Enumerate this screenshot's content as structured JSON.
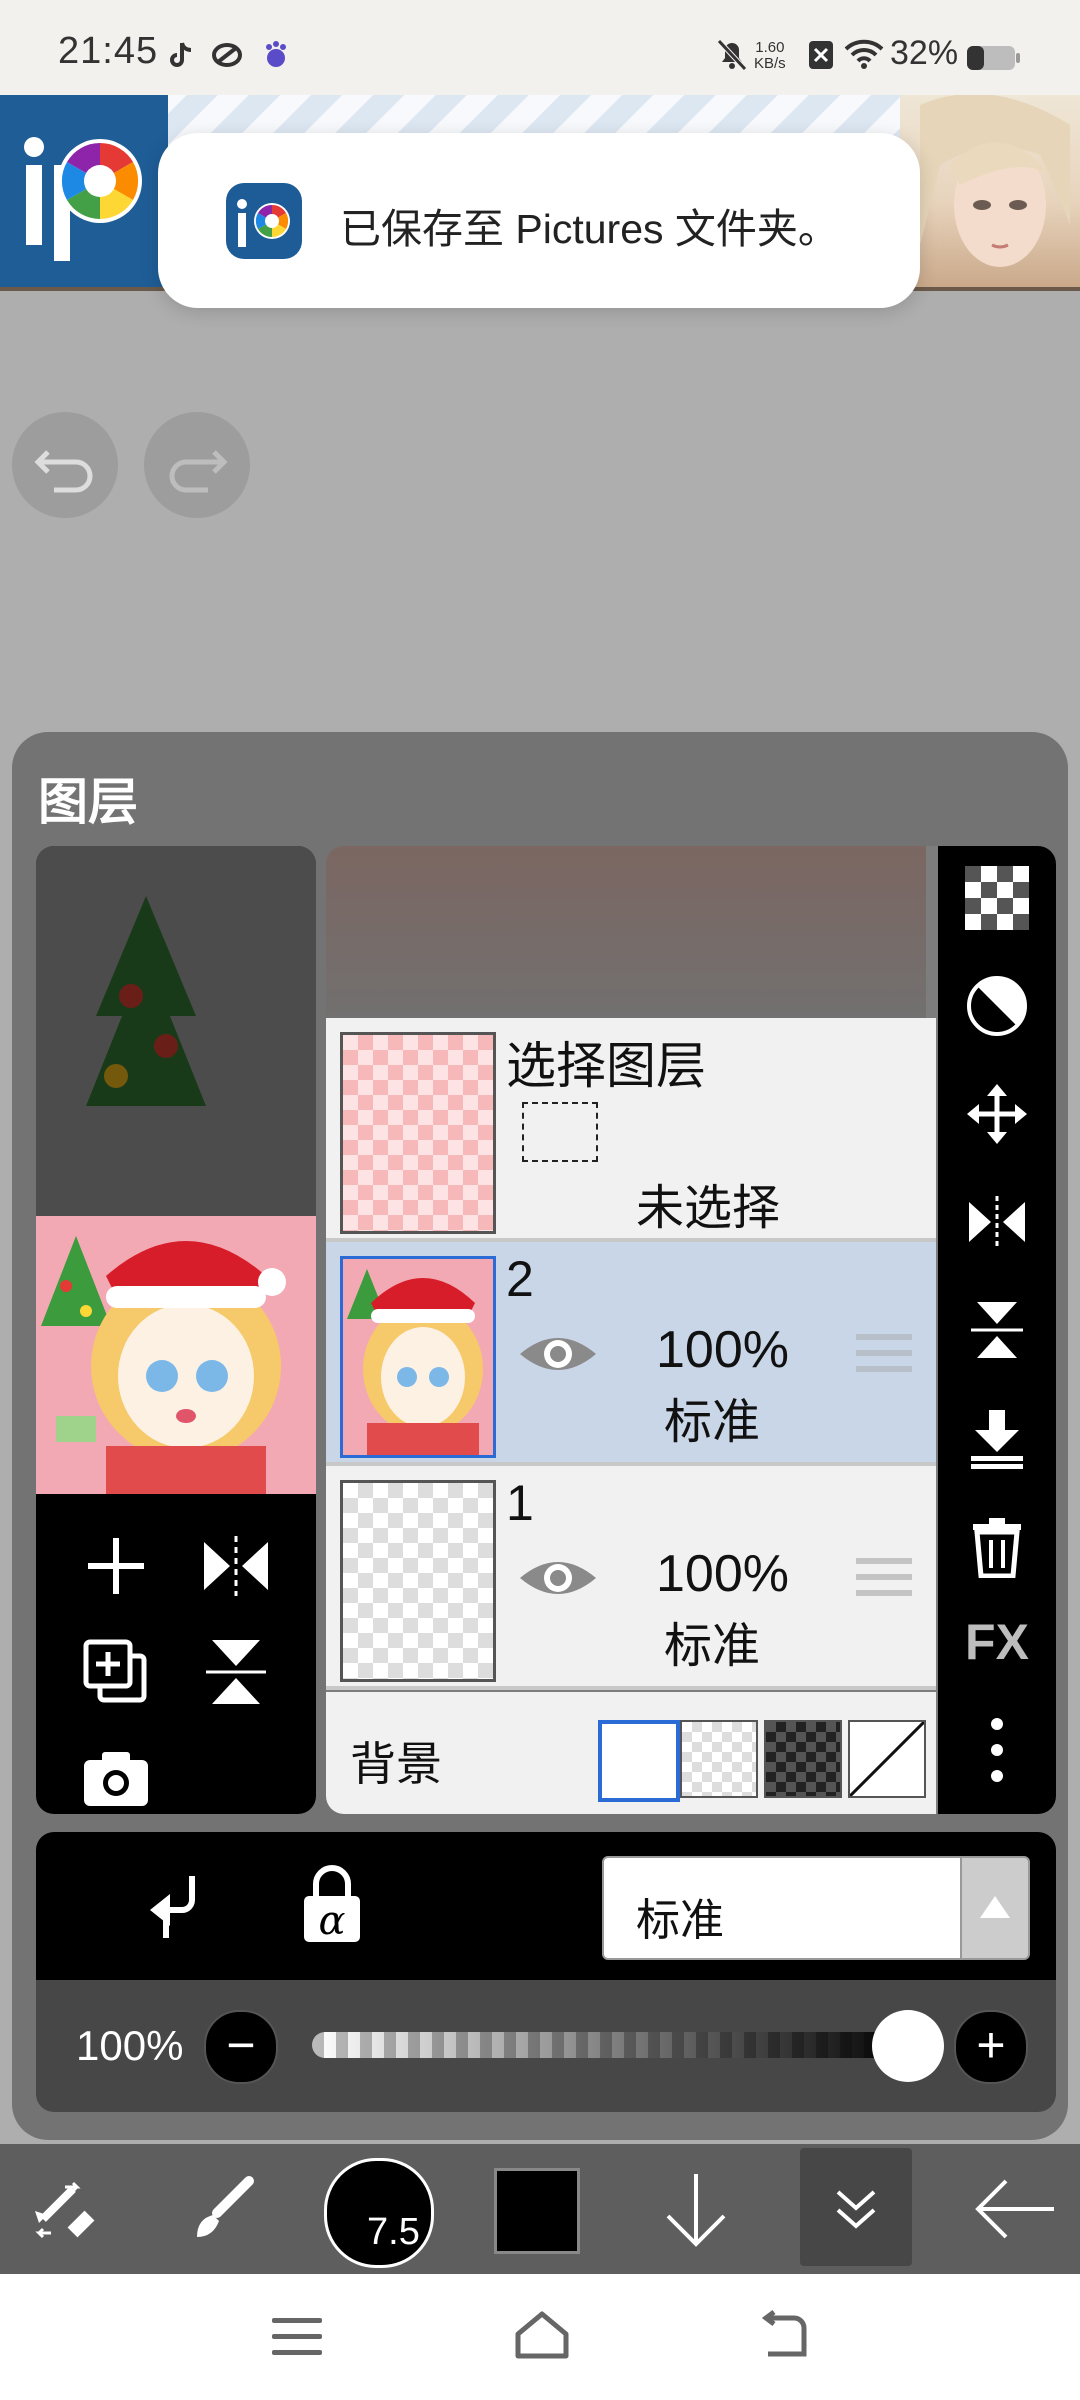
{
  "status_bar": {
    "time": "21:45",
    "net_speed_value": "1.60",
    "net_speed_unit": "KB/s",
    "battery_percent": "32%"
  },
  "toast": {
    "message": "已保存至 Pictures 文件夹。"
  },
  "panel": {
    "title": "图层"
  },
  "layers": [
    {
      "name": "选择图层",
      "status": "未选择"
    },
    {
      "name": "2",
      "opacity": "100%",
      "mode": "标准",
      "selected": true
    },
    {
      "name": "1",
      "opacity": "100%",
      "mode": "标准",
      "selected": false
    }
  ],
  "background": {
    "label": "背景"
  },
  "right_tools": {
    "fx_label": "FX"
  },
  "blend": {
    "mode_value": "标准"
  },
  "opacity_control": {
    "value": "100%",
    "minus_label": "−",
    "plus_label": "+",
    "level": 1.0
  },
  "toolbar": {
    "brush_size": "7.5"
  },
  "colors": {
    "selected_row": "#c9d6e8",
    "panel_bg": "#737373",
    "accent_blue": "#2b6bd6"
  }
}
